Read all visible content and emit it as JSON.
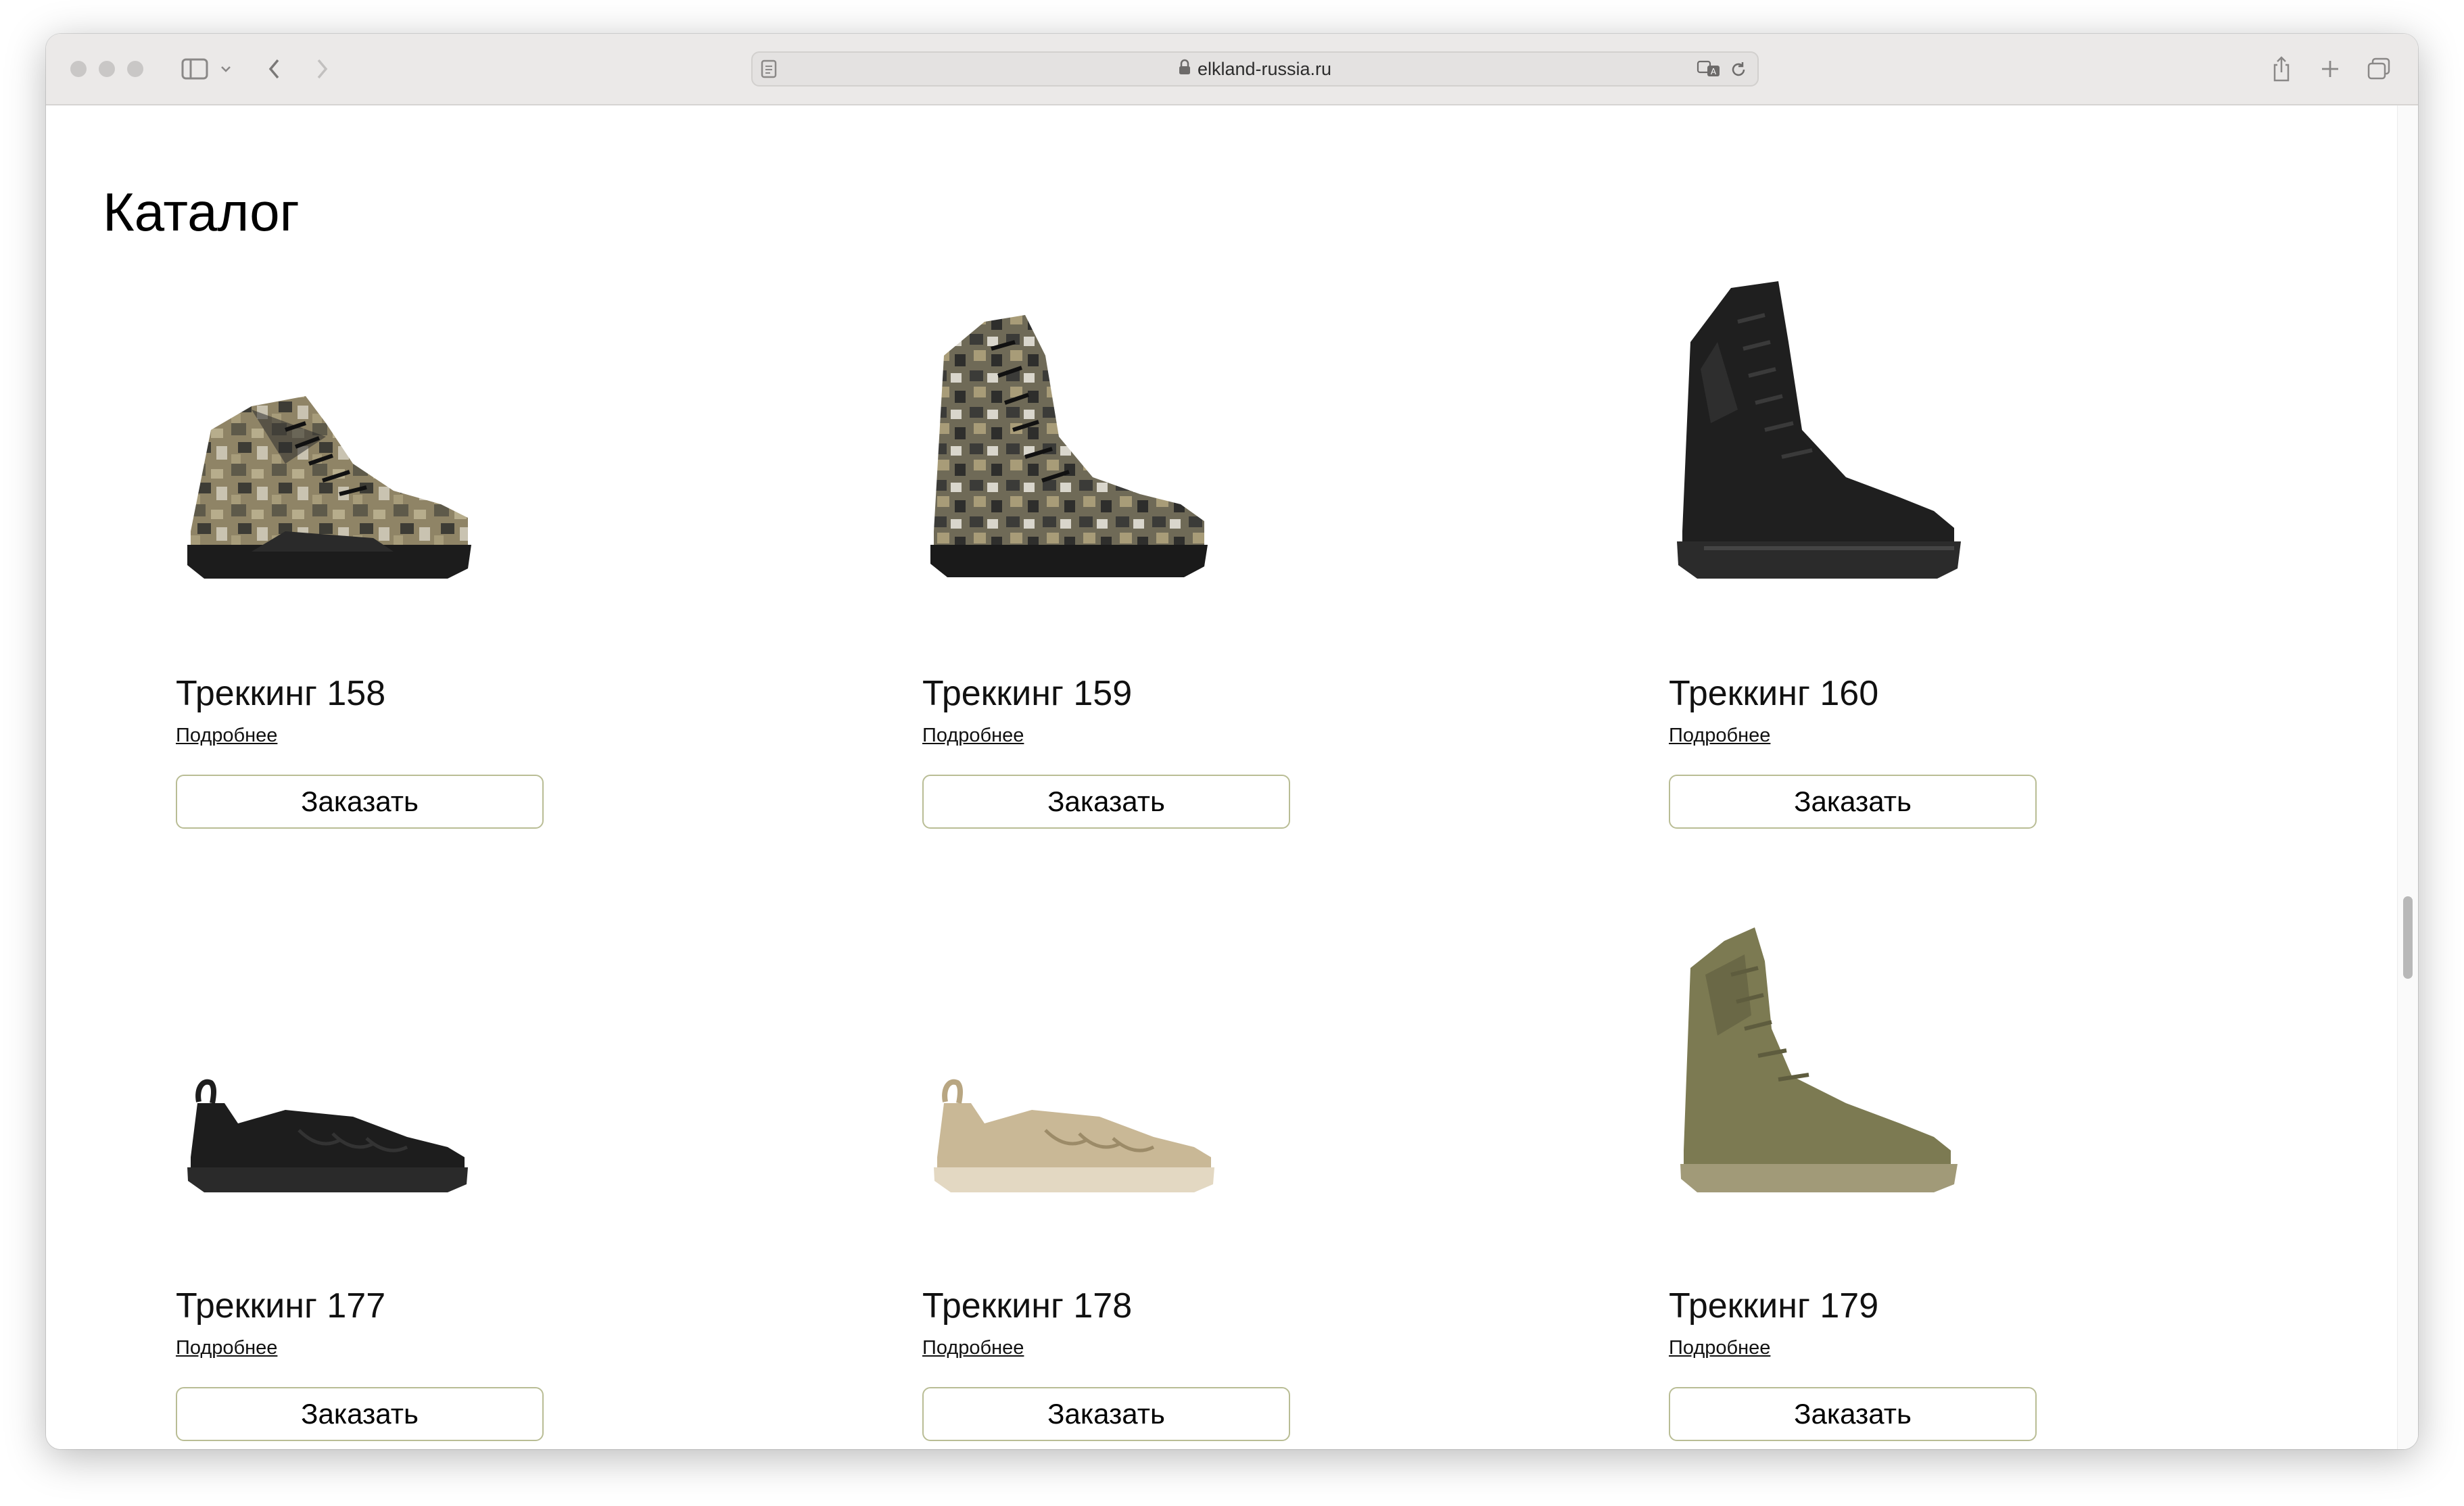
{
  "browser": {
    "url": "elkland-russia.ru"
  },
  "page": {
    "title": "Каталог"
  },
  "products": [
    {
      "name": "Треккинг 158",
      "details_link": "Подробнее",
      "order_label": "Заказать",
      "style": "camo-mid-boot"
    },
    {
      "name": "Треккинг 159",
      "details_link": "Подробнее",
      "order_label": "Заказать",
      "style": "camo-high-boot"
    },
    {
      "name": "Треккинг 160",
      "details_link": "Подробнее",
      "order_label": "Заказать",
      "style": "black-tactical-boot"
    },
    {
      "name": "Треккинг 177",
      "details_link": "Подробнее",
      "order_label": "Заказать",
      "style": "black-sneaker"
    },
    {
      "name": "Треккинг 178",
      "details_link": "Подробнее",
      "order_label": "Заказать",
      "style": "sand-sneaker"
    },
    {
      "name": "Треккинг 179",
      "details_link": "Подробнее",
      "order_label": "Заказать",
      "style": "olive-high-boot"
    }
  ],
  "colors": {
    "button_border": "#b9bd95",
    "toolbar_bg": "#ebe9e8"
  }
}
